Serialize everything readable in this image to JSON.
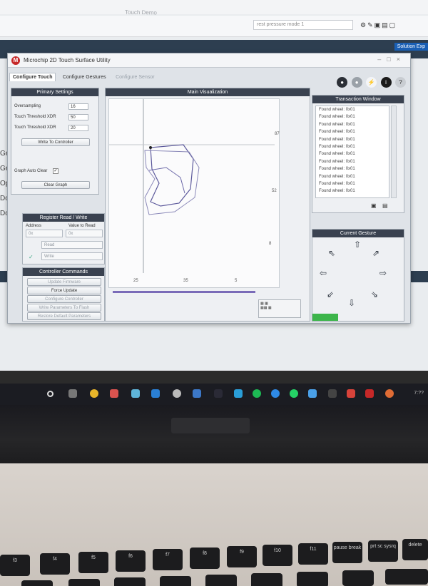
{
  "window": {
    "title": "Microchip 2D Touch Surface Utility",
    "tabs": [
      "Configure Touch",
      "Configure Gestures",
      "Configure Sensor"
    ]
  },
  "primary_settings": {
    "header": "Primary Settings",
    "rows": [
      {
        "label": "Oversampling",
        "value": "16"
      },
      {
        "label": "Touch Threshold XDR",
        "value": "50"
      },
      {
        "label": "Touch Threshold XDR",
        "value": "20"
      }
    ],
    "write_button": "Write To Controller",
    "graph_auto_clear": "Graph Auto Clear",
    "clear_graph_button": "Clear Graph"
  },
  "register_panel": {
    "header": "Register Read / Write",
    "address_label": "Address",
    "value_label": "Value to Read",
    "address_value": "0x",
    "value_value": "0x",
    "read_field": "Read",
    "write_field": "Write"
  },
  "controller_commands": {
    "header": "Controller Commands",
    "buttons": [
      "Update Firmware",
      "Force Update",
      "Configure Controller",
      "Write Parameters To Flash",
      "Restore Default Parameters"
    ]
  },
  "main_viz": {
    "header": "Main Visualization",
    "y_ticks": [
      "87",
      "52",
      "8"
    ],
    "x_ticks": [
      "25",
      "35",
      "5"
    ]
  },
  "transaction": {
    "header": "Transaction Window",
    "items": [
      "Found wheel: 0x01",
      "Found wheel: 0x01",
      "Found wheel: 0x01",
      "Found wheel: 0x01",
      "Found wheel: 0x01",
      "Found wheel: 0x01",
      "Found wheel: 0x01",
      "Found wheel: 0x01",
      "Found wheel: 0x01",
      "Found wheel: 0x01",
      "Found wheel: 0x01",
      "Found wheel: 0x01"
    ]
  },
  "current_gesture": {
    "header": "Current Gesture"
  },
  "background": {
    "tab_text": "Touch Demo",
    "search_value": "rest pressure mode 1",
    "band_label": "Solution Exp",
    "side_items": [
      "Ge",
      "Ge",
      "Op",
      "Do",
      "Do"
    ]
  },
  "keyboard": {
    "fkeys": [
      "f3",
      "f4",
      "f5",
      "f6",
      "f7",
      "f8",
      "f9",
      "f10",
      "f11",
      "f12",
      "pause break",
      "prt sc sysrq",
      "delete"
    ]
  },
  "tray": {
    "time": "7:??"
  }
}
